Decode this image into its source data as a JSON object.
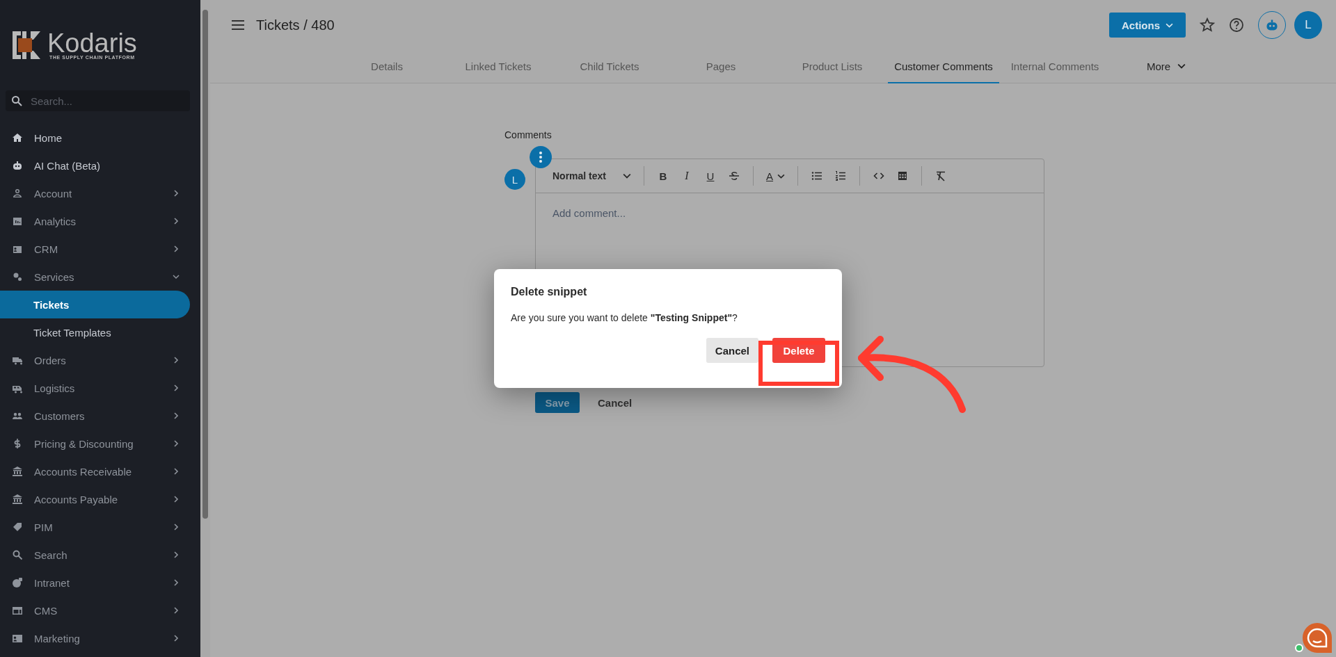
{
  "sidebar": {
    "logo": {
      "name": "Kodaris",
      "tagline": "THE SUPPLY CHAIN PLATFORM"
    },
    "search": {
      "placeholder": "Search..."
    },
    "items": [
      {
        "label": "Home",
        "kind": "link",
        "selected": false
      },
      {
        "label": "AI Chat (Beta)",
        "kind": "link",
        "selected": false
      },
      {
        "label": "Account",
        "kind": "group",
        "expanded": false,
        "selected": false
      },
      {
        "label": "Analytics",
        "kind": "group",
        "expanded": false,
        "selected": false
      },
      {
        "label": "CRM",
        "kind": "group",
        "expanded": false,
        "selected": false
      },
      {
        "label": "Services",
        "kind": "group",
        "expanded": true,
        "selected": false,
        "children": [
          {
            "label": "Tickets",
            "selected": true
          },
          {
            "label": "Ticket Templates",
            "selected": false
          }
        ]
      },
      {
        "label": "Orders",
        "kind": "group",
        "expanded": false,
        "selected": false
      },
      {
        "label": "Logistics",
        "kind": "group",
        "expanded": false,
        "selected": false
      },
      {
        "label": "Customers",
        "kind": "group",
        "expanded": false,
        "selected": false
      },
      {
        "label": "Pricing & Discounting",
        "kind": "group",
        "expanded": false,
        "selected": false
      },
      {
        "label": "Accounts Receivable",
        "kind": "group",
        "expanded": false,
        "selected": false
      },
      {
        "label": "Accounts Payable",
        "kind": "group",
        "expanded": false,
        "selected": false
      },
      {
        "label": "PIM",
        "kind": "group",
        "expanded": false,
        "selected": false
      },
      {
        "label": "Search",
        "kind": "group",
        "expanded": false,
        "selected": false
      },
      {
        "label": "Intranet",
        "kind": "group",
        "expanded": false,
        "selected": false
      },
      {
        "label": "CMS",
        "kind": "group",
        "expanded": false,
        "selected": false
      },
      {
        "label": "Marketing",
        "kind": "group",
        "expanded": false,
        "selected": false
      }
    ]
  },
  "header": {
    "title": "Tickets / 480",
    "actions_button": "Actions",
    "avatar": "L"
  },
  "tabs": [
    {
      "label": "Details",
      "kind": "tab",
      "selected": false
    },
    {
      "label": "Linked Tickets",
      "kind": "tab",
      "selected": false
    },
    {
      "label": "Child Tickets",
      "kind": "tab",
      "selected": false
    },
    {
      "label": "Pages",
      "kind": "tab",
      "selected": false
    },
    {
      "label": "Product Lists",
      "kind": "tab",
      "selected": false
    },
    {
      "label": "Customer Comments",
      "kind": "tab",
      "selected": true
    },
    {
      "label": "Internal Comments",
      "kind": "tab",
      "selected": false
    },
    {
      "label": "More",
      "kind": "menu",
      "selected": false
    }
  ],
  "comments": {
    "label": "Comments",
    "avatar": "L",
    "toolbar": {
      "block_format": "Normal text",
      "bold": "B",
      "italic": "I",
      "underline": "U",
      "text_color": "A"
    },
    "placeholder": "Add comment...",
    "buttons": [
      {
        "label": "Save",
        "kind": "primary"
      },
      {
        "label": "Cancel",
        "kind": "plain"
      }
    ]
  },
  "dialog": {
    "title": "Delete snippet",
    "message": "Are you sure you want to delete **\"Testing Snippet\"**?",
    "buttons": [
      {
        "label": "Cancel",
        "kind": "secondary"
      },
      {
        "label": "Delete",
        "kind": "danger"
      }
    ]
  }
}
